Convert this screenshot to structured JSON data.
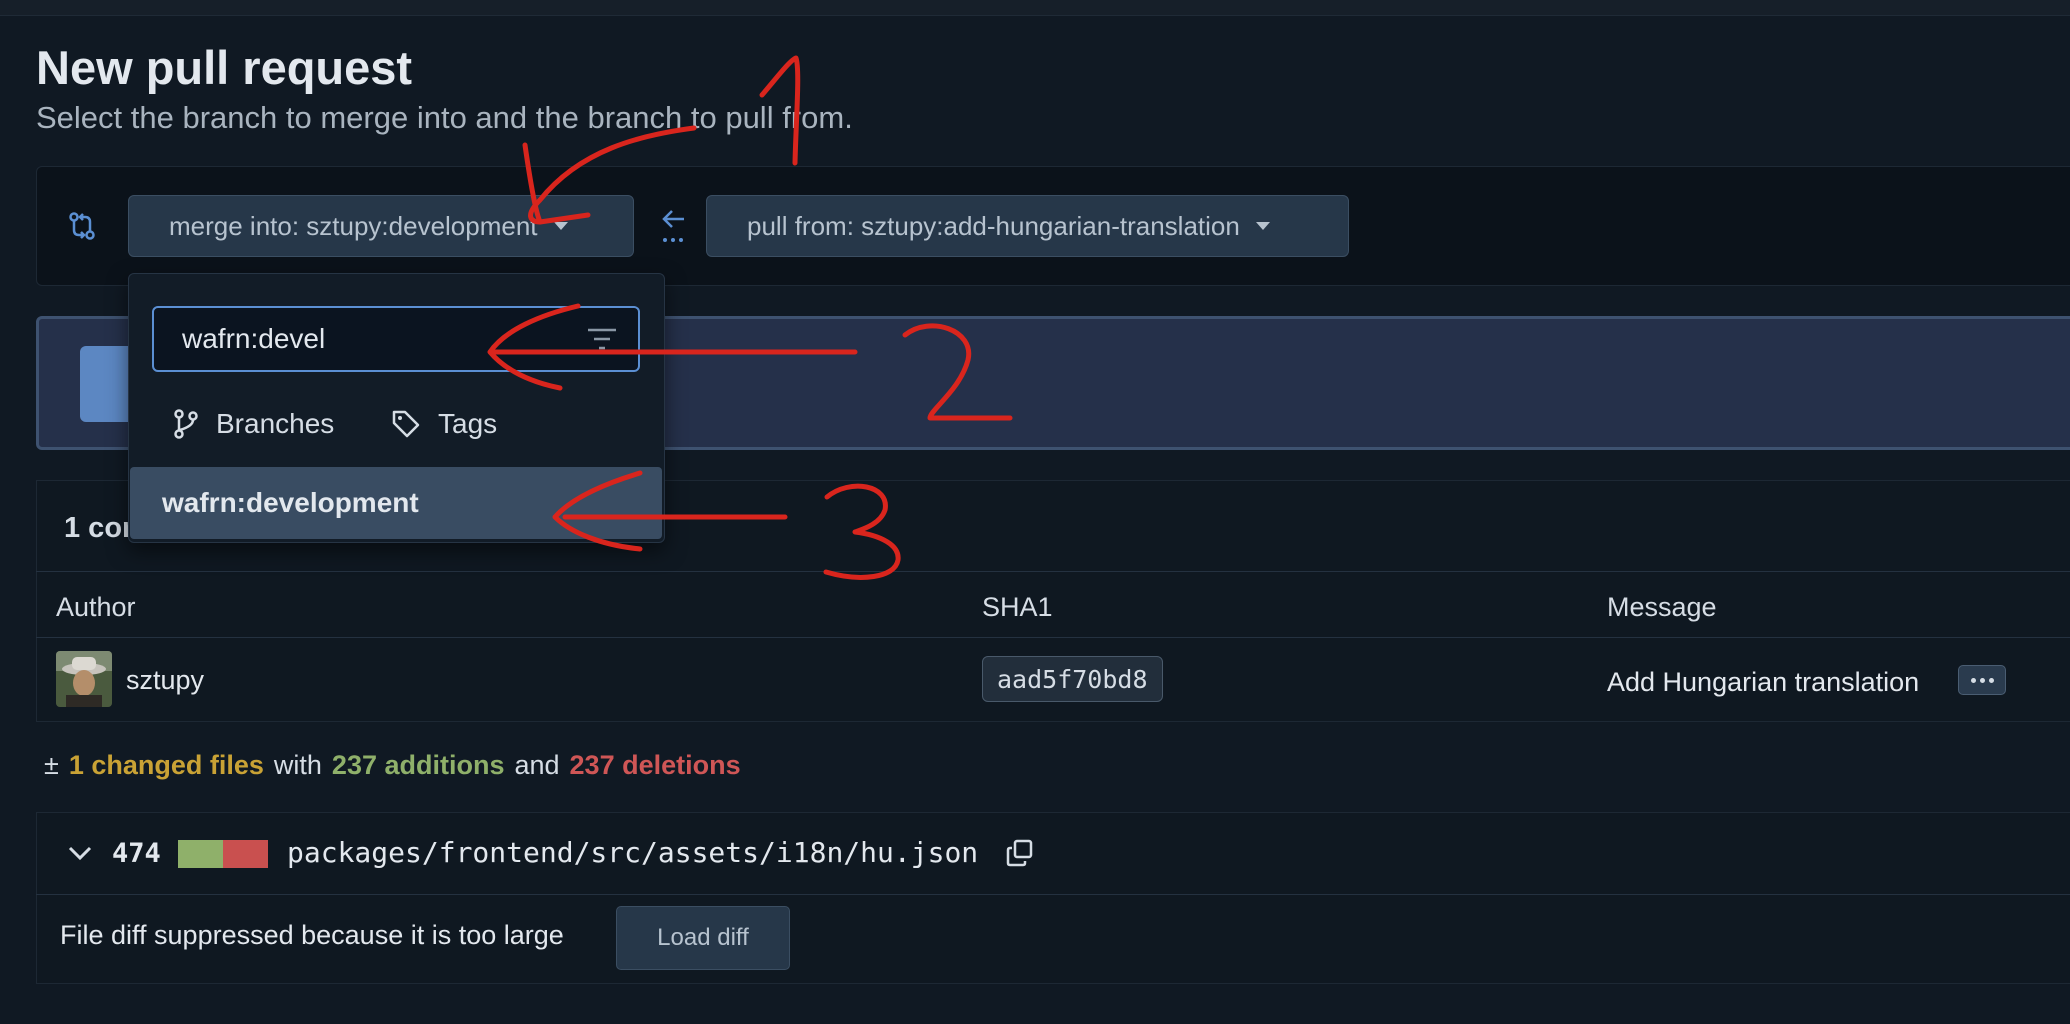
{
  "page": {
    "title": "New pull request",
    "subtitle": "Select the branch to merge into and the branch to pull from."
  },
  "compare": {
    "merge_into_label": "merge into: sztupy:development",
    "pull_from_label": "pull from: sztupy:add-hungarian-translation"
  },
  "dropdown": {
    "search_value": "wafrn:devel",
    "tab_branches": "Branches",
    "tab_tags": "Tags",
    "result": "wafrn:development"
  },
  "commits": {
    "summary": "1 cor",
    "columns": [
      "Author",
      "SHA1",
      "Message"
    ],
    "rows": [
      {
        "author": "sztupy",
        "sha": "aad5f70bd8",
        "message": "Add Hungarian translation"
      }
    ]
  },
  "stats": {
    "icon": "±",
    "changed_files": "1 changed files",
    "with": "with",
    "additions": "237 additions",
    "and": "and",
    "deletions": "237 deletions"
  },
  "file": {
    "count": "474",
    "additions_fraction": 0.5,
    "path": "packages/frontend/src/assets/i18n/hu.json",
    "suppressed_text": "File diff suppressed because it is too large",
    "load_button": "Load diff"
  },
  "colors": {
    "accent": "#5b8fd3",
    "additions": "#8fb06a",
    "deletions": "#cf5656",
    "changed": "#c9a235",
    "annotation": "#d9251d"
  },
  "annotations": {
    "marks": [
      "1",
      "2",
      "3"
    ]
  }
}
